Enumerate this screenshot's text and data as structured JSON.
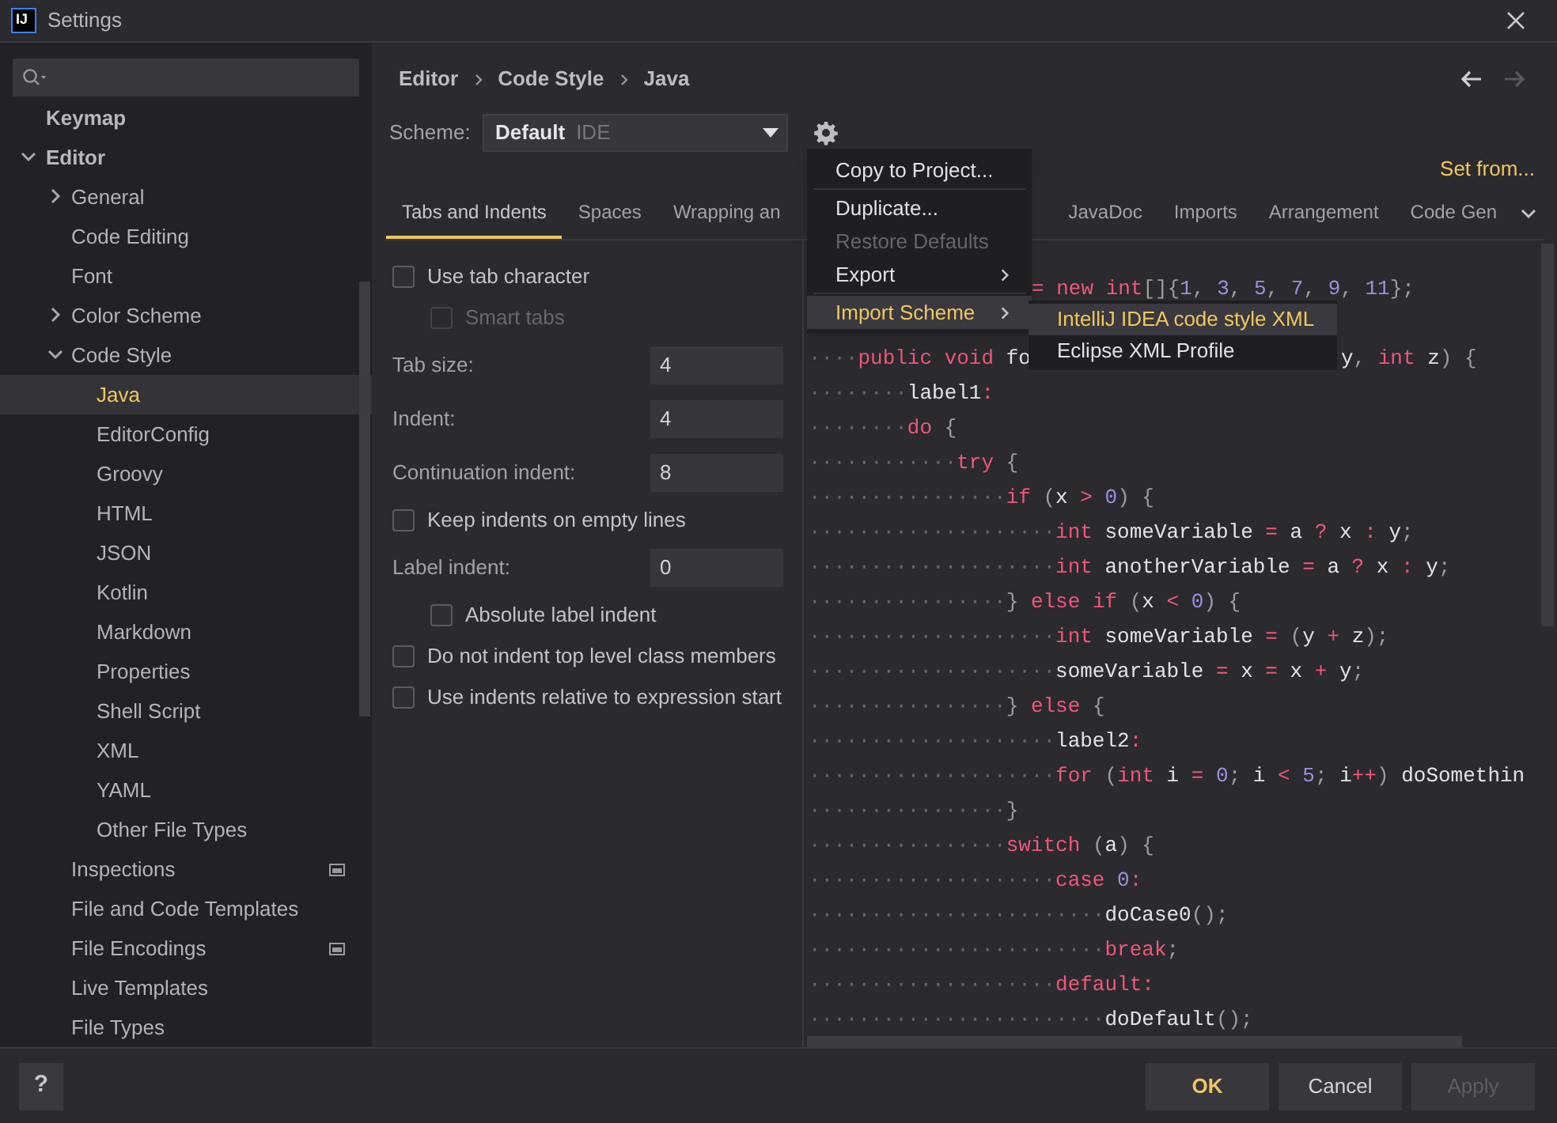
{
  "window": {
    "logo": "IJ",
    "title": "Settings"
  },
  "sidebar": {
    "items": [
      {
        "label": "Keymap",
        "selected": false
      },
      {
        "label": "Editor",
        "selected": false,
        "expanded": true,
        "children": [
          {
            "label": "General",
            "selected": false,
            "expanded": false
          },
          {
            "label": "Code Editing",
            "selected": false
          },
          {
            "label": "Font",
            "selected": false
          },
          {
            "label": "Color Scheme",
            "selected": false,
            "expanded": false
          },
          {
            "label": "Code Style",
            "selected": false,
            "expanded": true,
            "children": [
              {
                "label": "Java",
                "selected": true
              },
              {
                "label": "EditorConfig",
                "selected": false
              },
              {
                "label": "Groovy",
                "selected": false
              },
              {
                "label": "HTML",
                "selected": false
              },
              {
                "label": "JSON",
                "selected": false
              },
              {
                "label": "Kotlin",
                "selected": false
              },
              {
                "label": "Markdown",
                "selected": false
              },
              {
                "label": "Properties",
                "selected": false
              },
              {
                "label": "Shell Script",
                "selected": false
              },
              {
                "label": "XML",
                "selected": false
              },
              {
                "label": "YAML",
                "selected": false
              },
              {
                "label": "Other File Types",
                "selected": false
              }
            ]
          },
          {
            "label": "Inspections",
            "selected": false,
            "project_scope": true
          },
          {
            "label": "File and Code Templates",
            "selected": false
          },
          {
            "label": "File Encodings",
            "selected": false,
            "project_scope": true
          },
          {
            "label": "Live Templates",
            "selected": false
          },
          {
            "label": "File Types",
            "selected": false
          }
        ]
      }
    ]
  },
  "breadcrumb": [
    "Editor",
    "Code Style",
    "Java"
  ],
  "navigation": {
    "back_disabled": false,
    "forward_disabled": true
  },
  "scheme": {
    "label": "Scheme:",
    "name": "Default",
    "source": "IDE"
  },
  "set_from": "Set from...",
  "tabs": [
    {
      "label": "Tabs and Indents",
      "selected": true
    },
    {
      "label": "Spaces",
      "selected": false
    },
    {
      "label": "Wrapping an",
      "selected": false
    },
    {
      "label": "JavaDoc",
      "selected": false
    },
    {
      "label": "Imports",
      "selected": false
    },
    {
      "label": "Arrangement",
      "selected": false
    },
    {
      "label": "Code Gen",
      "selected": false
    }
  ],
  "form": [
    {
      "kind": "checkbox",
      "label": "Use tab character",
      "checked": false,
      "disabled": false,
      "children": [
        {
          "kind": "checkbox",
          "label": "Smart tabs",
          "checked": false,
          "disabled": true
        }
      ]
    },
    {
      "kind": "number",
      "label": "Tab size:",
      "value": "4"
    },
    {
      "kind": "number",
      "label": "Indent:",
      "value": "4"
    },
    {
      "kind": "number",
      "label": "Continuation indent:",
      "value": "8"
    },
    {
      "kind": "checkbox",
      "label": "Keep indents on empty lines",
      "checked": false,
      "disabled": false
    },
    {
      "kind": "number",
      "label": "Label indent:",
      "value": "0",
      "children": [
        {
          "kind": "checkbox",
          "label": "Absolute label indent",
          "checked": false,
          "disabled": false
        }
      ]
    },
    {
      "kind": "checkbox",
      "label": "Do not indent top level class members",
      "checked": false,
      "disabled": false
    },
    {
      "kind": "checkbox",
      "label": "Use indents relative to expression start",
      "checked": false,
      "disabled": false
    }
  ],
  "code": [
    {
      "kind": "after_menu",
      "tokens": [
        {
          "kind": "op",
          "text": "= "
        },
        {
          "kind": "kw",
          "text": "new "
        },
        {
          "kind": "kw",
          "text": "int"
        },
        {
          "kind": "punc",
          "text": "[]{"
        },
        {
          "kind": "num",
          "text": "1"
        },
        {
          "kind": "punc",
          "text": ", "
        },
        {
          "kind": "num",
          "text": "3"
        },
        {
          "kind": "punc",
          "text": ", "
        },
        {
          "kind": "num",
          "text": "5"
        },
        {
          "kind": "punc",
          "text": ", "
        },
        {
          "kind": "num",
          "text": "7"
        },
        {
          "kind": "punc",
          "text": ", "
        },
        {
          "kind": "num",
          "text": "9"
        },
        {
          "kind": "punc",
          "text": ", "
        },
        {
          "kind": "num",
          "text": "11"
        },
        {
          "kind": "punc",
          "text": "};"
        }
      ]
    },
    {
      "kind": "blank"
    },
    {
      "kind": "split",
      "indent": "····",
      "tokens": [
        {
          "kind": "kw",
          "text": "public "
        },
        {
          "kind": "kw",
          "text": "void "
        },
        {
          "kind": "id",
          "text": "fo"
        }
      ],
      "rest": [
        {
          "kind": "id",
          "text": "y"
        },
        {
          "kind": "punc",
          "text": ", "
        },
        {
          "kind": "kw",
          "text": "int "
        },
        {
          "kind": "id",
          "text": "z"
        },
        {
          "kind": "punc",
          "text": ") {"
        }
      ]
    },
    {
      "kind": "code",
      "indent": "········",
      "tokens": [
        {
          "kind": "id",
          "text": "label1"
        },
        {
          "kind": "op",
          "text": ":"
        }
      ]
    },
    {
      "kind": "code",
      "indent": "········",
      "tokens": [
        {
          "kind": "kw",
          "text": "do "
        },
        {
          "kind": "punc",
          "text": "{"
        }
      ]
    },
    {
      "kind": "code",
      "indent": "············",
      "tokens": [
        {
          "kind": "kw",
          "text": "try "
        },
        {
          "kind": "punc",
          "text": "{"
        }
      ]
    },
    {
      "kind": "code",
      "indent": "················",
      "tokens": [
        {
          "kind": "kw",
          "text": "if "
        },
        {
          "kind": "punc",
          "text": "("
        },
        {
          "kind": "id",
          "text": "x "
        },
        {
          "kind": "op",
          "text": "> "
        },
        {
          "kind": "num",
          "text": "0"
        },
        {
          "kind": "punc",
          "text": ") {"
        }
      ]
    },
    {
      "kind": "code",
      "indent": "····················",
      "tokens": [
        {
          "kind": "kw",
          "text": "int "
        },
        {
          "kind": "id",
          "text": "someVariable "
        },
        {
          "kind": "op",
          "text": "= "
        },
        {
          "kind": "id",
          "text": "a "
        },
        {
          "kind": "op",
          "text": "? "
        },
        {
          "kind": "id",
          "text": "x "
        },
        {
          "kind": "op",
          "text": ": "
        },
        {
          "kind": "id",
          "text": "y"
        },
        {
          "kind": "punc",
          "text": ";"
        }
      ]
    },
    {
      "kind": "code",
      "indent": "····················",
      "tokens": [
        {
          "kind": "kw",
          "text": "int "
        },
        {
          "kind": "id",
          "text": "anotherVariable "
        },
        {
          "kind": "op",
          "text": "= "
        },
        {
          "kind": "id",
          "text": "a "
        },
        {
          "kind": "op",
          "text": "? "
        },
        {
          "kind": "id",
          "text": "x "
        },
        {
          "kind": "op",
          "text": ": "
        },
        {
          "kind": "id",
          "text": "y"
        },
        {
          "kind": "punc",
          "text": ";"
        }
      ]
    },
    {
      "kind": "code",
      "indent": "················",
      "tokens": [
        {
          "kind": "punc",
          "text": "} "
        },
        {
          "kind": "kw",
          "text": "else if "
        },
        {
          "kind": "punc",
          "text": "("
        },
        {
          "kind": "id",
          "text": "x "
        },
        {
          "kind": "op",
          "text": "< "
        },
        {
          "kind": "num",
          "text": "0"
        },
        {
          "kind": "punc",
          "text": ") {"
        }
      ]
    },
    {
      "kind": "code",
      "indent": "····················",
      "tokens": [
        {
          "kind": "kw",
          "text": "int "
        },
        {
          "kind": "id",
          "text": "someVariable "
        },
        {
          "kind": "op",
          "text": "= "
        },
        {
          "kind": "punc",
          "text": "("
        },
        {
          "kind": "id",
          "text": "y "
        },
        {
          "kind": "op",
          "text": "+ "
        },
        {
          "kind": "id",
          "text": "z"
        },
        {
          "kind": "punc",
          "text": ");"
        }
      ]
    },
    {
      "kind": "code",
      "indent": "····················",
      "tokens": [
        {
          "kind": "id",
          "text": "someVariable "
        },
        {
          "kind": "op",
          "text": "= "
        },
        {
          "kind": "id",
          "text": "x "
        },
        {
          "kind": "op",
          "text": "= "
        },
        {
          "kind": "id",
          "text": "x "
        },
        {
          "kind": "op",
          "text": "+ "
        },
        {
          "kind": "id",
          "text": "y"
        },
        {
          "kind": "punc",
          "text": ";"
        }
      ]
    },
    {
      "kind": "code",
      "indent": "················",
      "tokens": [
        {
          "kind": "punc",
          "text": "} "
        },
        {
          "kind": "kw",
          "text": "else "
        },
        {
          "kind": "punc",
          "text": "{"
        }
      ]
    },
    {
      "kind": "code",
      "indent": "····················",
      "tokens": [
        {
          "kind": "id",
          "text": "label2"
        },
        {
          "kind": "op",
          "text": ":"
        }
      ]
    },
    {
      "kind": "code",
      "indent": "····················",
      "tokens": [
        {
          "kind": "kw",
          "text": "for "
        },
        {
          "kind": "punc",
          "text": "("
        },
        {
          "kind": "kw",
          "text": "int "
        },
        {
          "kind": "id",
          "text": "i "
        },
        {
          "kind": "op",
          "text": "= "
        },
        {
          "kind": "num",
          "text": "0"
        },
        {
          "kind": "punc",
          "text": "; "
        },
        {
          "kind": "id",
          "text": "i "
        },
        {
          "kind": "op",
          "text": "< "
        },
        {
          "kind": "num",
          "text": "5"
        },
        {
          "kind": "punc",
          "text": "; "
        },
        {
          "kind": "id",
          "text": "i"
        },
        {
          "kind": "op",
          "text": "++"
        },
        {
          "kind": "punc",
          "text": ") "
        },
        {
          "kind": "id",
          "text": "doSomethin"
        }
      ]
    },
    {
      "kind": "code",
      "indent": "················",
      "tokens": [
        {
          "kind": "punc",
          "text": "}"
        }
      ]
    },
    {
      "kind": "code",
      "indent": "················",
      "tokens": [
        {
          "kind": "kw",
          "text": "switch "
        },
        {
          "kind": "punc",
          "text": "("
        },
        {
          "kind": "id",
          "text": "a"
        },
        {
          "kind": "punc",
          "text": ") {"
        }
      ]
    },
    {
      "kind": "code",
      "indent": "····················",
      "tokens": [
        {
          "kind": "kw",
          "text": "case "
        },
        {
          "kind": "num",
          "text": "0"
        },
        {
          "kind": "op",
          "text": ":"
        }
      ]
    },
    {
      "kind": "code",
      "indent": "························",
      "tokens": [
        {
          "kind": "id",
          "text": "doCase0"
        },
        {
          "kind": "punc",
          "text": "();"
        }
      ]
    },
    {
      "kind": "code",
      "indent": "························",
      "tokens": [
        {
          "kind": "kw",
          "text": "break"
        },
        {
          "kind": "punc",
          "text": ";"
        }
      ]
    },
    {
      "kind": "code",
      "indent": "····················",
      "tokens": [
        {
          "kind": "kw",
          "text": "default"
        },
        {
          "kind": "op",
          "text": ":"
        }
      ]
    },
    {
      "kind": "code",
      "indent": "························",
      "tokens": [
        {
          "kind": "id",
          "text": "doDefault"
        },
        {
          "kind": "punc",
          "text": "();"
        }
      ]
    }
  ],
  "menu": [
    {
      "kind": "item",
      "label": "Copy to Project...",
      "disabled": false,
      "selected": false,
      "submenu": false
    },
    {
      "kind": "separator"
    },
    {
      "kind": "item",
      "label": "Duplicate...",
      "disabled": false,
      "selected": false,
      "submenu": false
    },
    {
      "kind": "item",
      "label": "Restore Defaults",
      "disabled": true,
      "selected": false,
      "submenu": false
    },
    {
      "kind": "item",
      "label": "Export",
      "disabled": false,
      "selected": false,
      "submenu": true
    },
    {
      "kind": "separator"
    },
    {
      "kind": "item",
      "label": "Import Scheme",
      "disabled": false,
      "selected": true,
      "submenu": true
    }
  ],
  "submenu": [
    {
      "label": "IntelliJ IDEA code style XML",
      "selected": true
    },
    {
      "label": "Eclipse XML Profile",
      "selected": false
    }
  ],
  "footer": {
    "help": "?",
    "buttons": [
      {
        "label": "OK",
        "kind": "default",
        "disabled": false
      },
      {
        "label": "Cancel",
        "kind": "normal",
        "disabled": false
      },
      {
        "label": "Apply",
        "kind": "normal",
        "disabled": true
      }
    ]
  }
}
